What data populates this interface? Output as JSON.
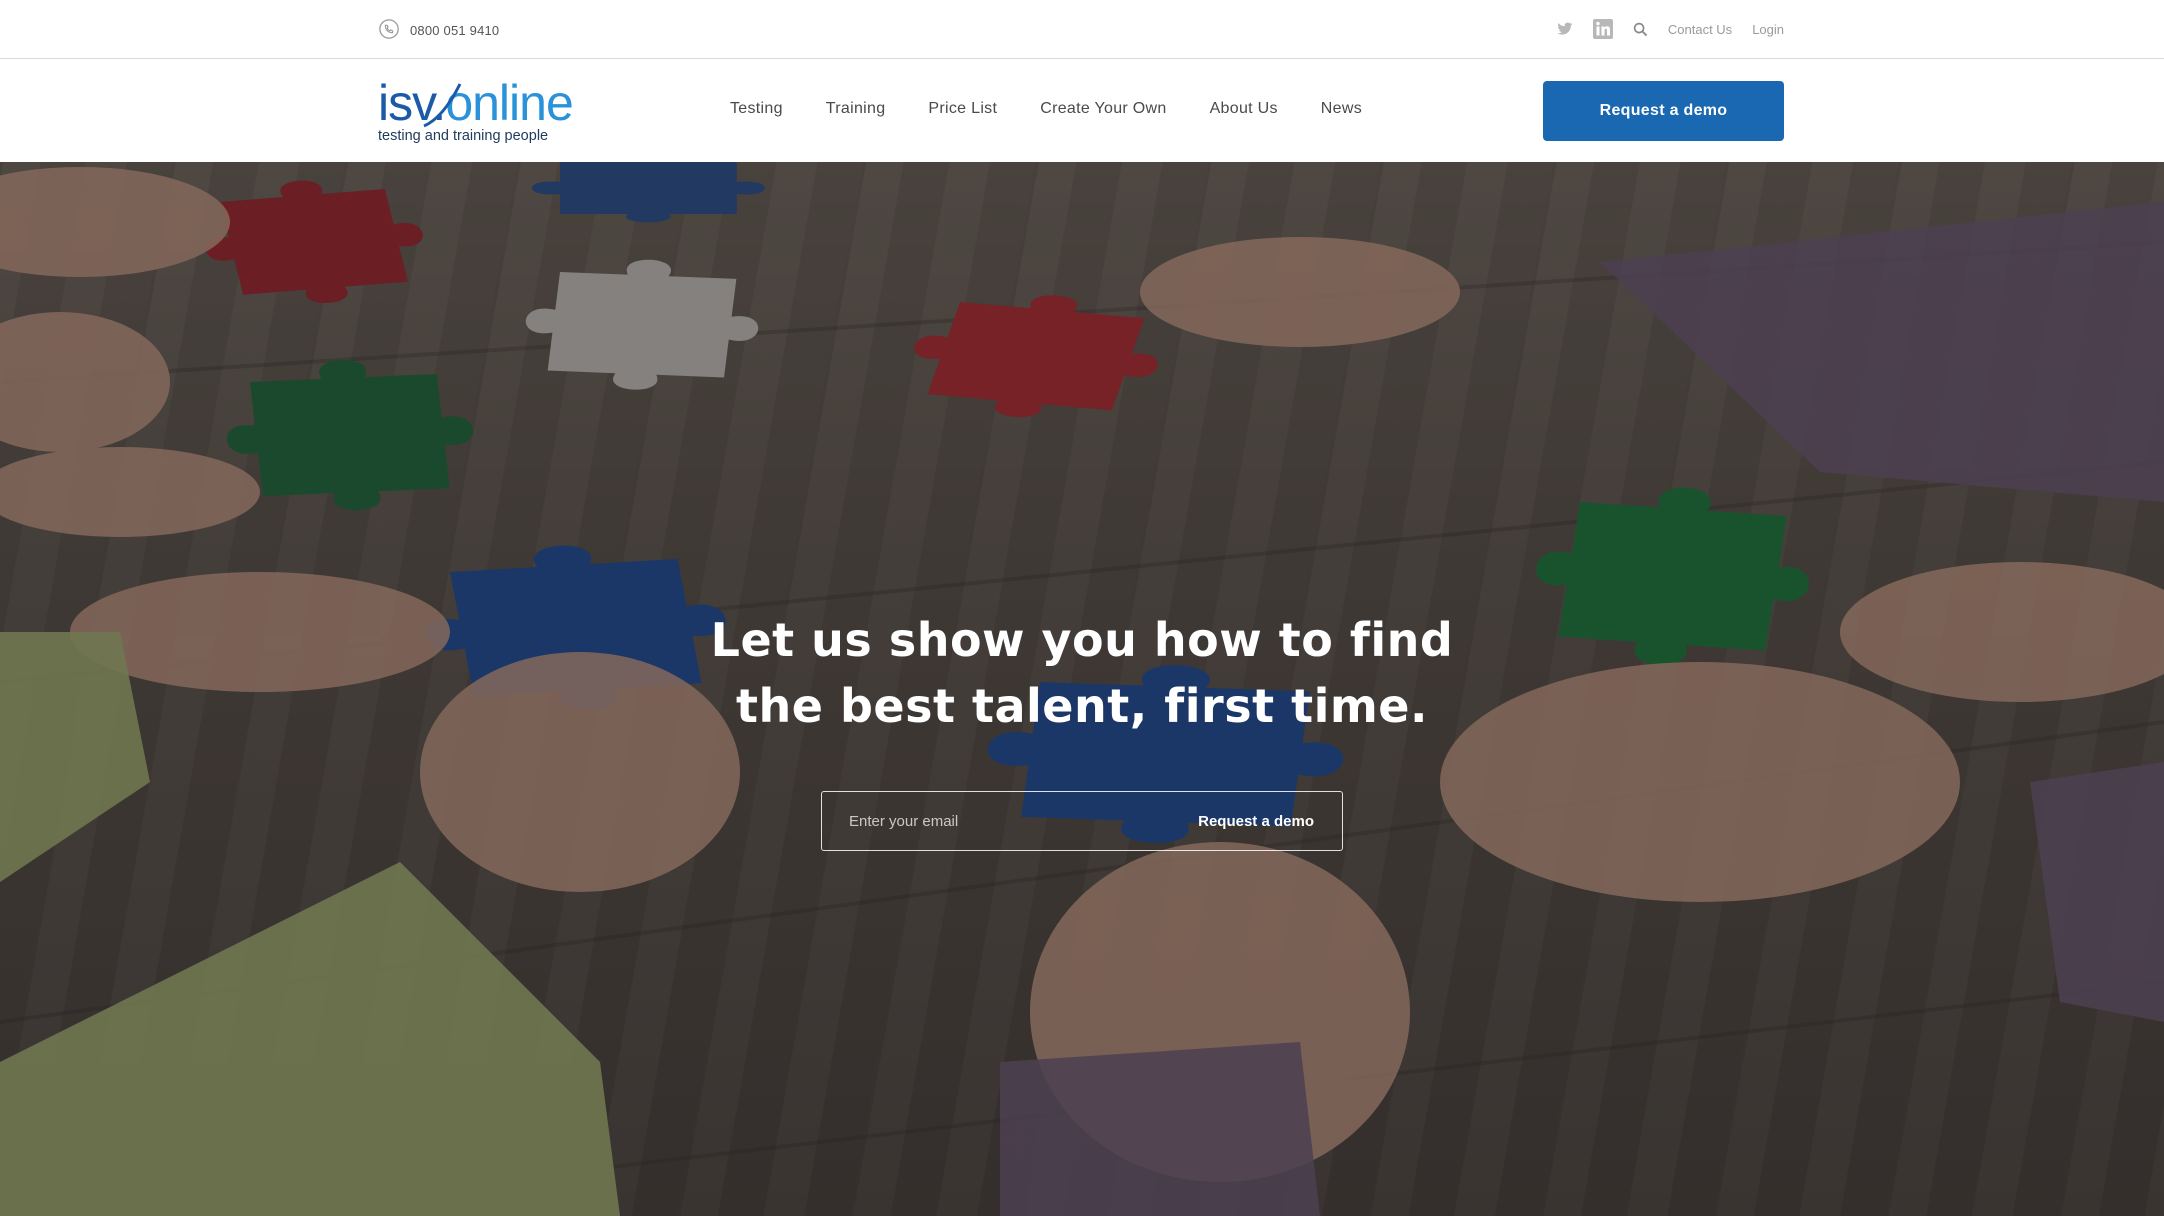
{
  "topbar": {
    "phone_number": "0800 051 9410",
    "phone_icon": "phone-icon",
    "social": [
      "twitter-icon",
      "linkedin-icon"
    ],
    "search_icon": "search-icon",
    "contact_label": "Contact Us",
    "login_label": "Login"
  },
  "logo": {
    "isv": "isv",
    "dot": ".",
    "online": "online",
    "tagline": "testing and training people"
  },
  "nav": {
    "items": [
      {
        "label": "Testing"
      },
      {
        "label": "Training"
      },
      {
        "label": "Price List"
      },
      {
        "label": "Create Your Own"
      },
      {
        "label": "About Us"
      },
      {
        "label": "News"
      }
    ],
    "cta_label": "Request a demo"
  },
  "hero": {
    "title_line1": "Let us show you how to find",
    "title_line2": "the best talent, first time.",
    "email_placeholder": "Enter your email",
    "submit_label": "Request a demo"
  },
  "colors": {
    "primary_blue": "#1a67b2",
    "logo_dark_blue": "#1a5aa8",
    "logo_light_blue": "#2a92d8",
    "puzzle_red": "#b3242e",
    "puzzle_green": "#1f7a3e",
    "puzzle_blue": "#1f4f9c"
  }
}
